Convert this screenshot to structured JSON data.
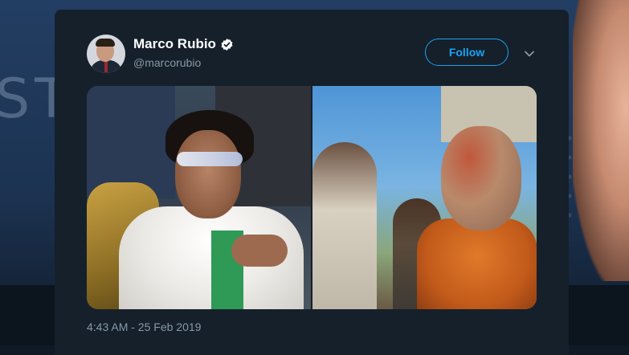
{
  "tweet": {
    "author": {
      "display_name": "Marco Rubio",
      "handle": "@marcorubio",
      "verified": true
    },
    "follow_label": "Follow",
    "timestamp": "4:43 AM - 25 Feb 2019",
    "media_count": 2
  },
  "backdrop": {
    "text": "STR"
  },
  "icons": {
    "verified": "verified-badge-icon",
    "more": "chevron-down-icon"
  },
  "colors": {
    "card_background": "#15202b",
    "accent": "#1da1f2",
    "secondary_text": "#8899a6",
    "primary_text": "#ffffff"
  }
}
